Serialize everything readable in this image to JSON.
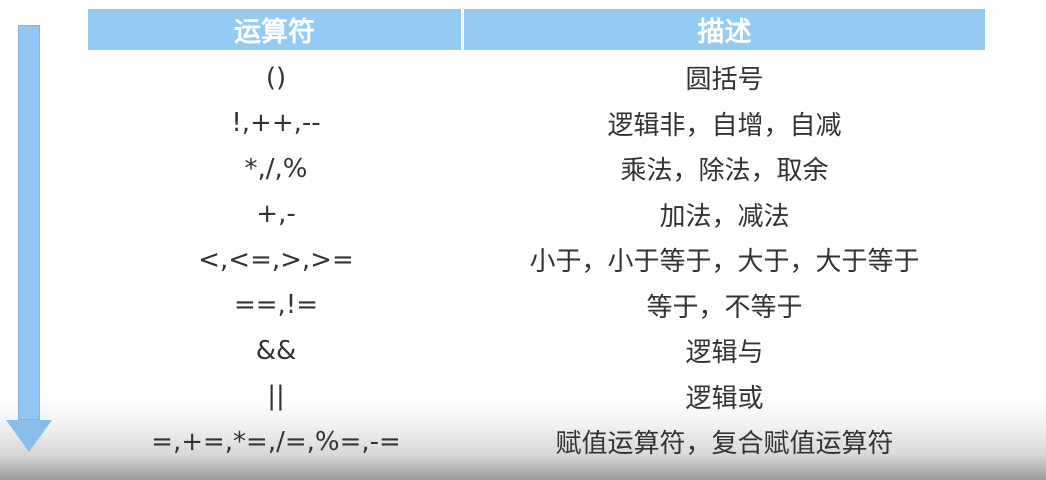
{
  "table": {
    "headers": [
      "运算符",
      "描述"
    ],
    "rows": [
      {
        "operator": "()",
        "description": "圆括号"
      },
      {
        "operator": "!,++,--",
        "description": "逻辑非，自增，自减"
      },
      {
        "operator": "*,/,%",
        "description": "乘法，除法，取余"
      },
      {
        "operator": "+,-",
        "description": "加法，减法"
      },
      {
        "operator": "<,<=,>,>=",
        "description": "小于，小于等于，大于，大于等于"
      },
      {
        "operator": "==,!=",
        "description": "等于，不等于"
      },
      {
        "operator": "&&",
        "description": "逻辑与"
      },
      {
        "operator": "||",
        "description": "逻辑或"
      },
      {
        "operator": "=,+=,*=,/=,%=,-=",
        "description": "赋值运算符，复合赋值运算符"
      }
    ]
  },
  "colors": {
    "header_bg": "#95caf3",
    "arrow": "#92c5ef"
  },
  "icons": {
    "precedence_arrow": "arrow-down-icon"
  }
}
